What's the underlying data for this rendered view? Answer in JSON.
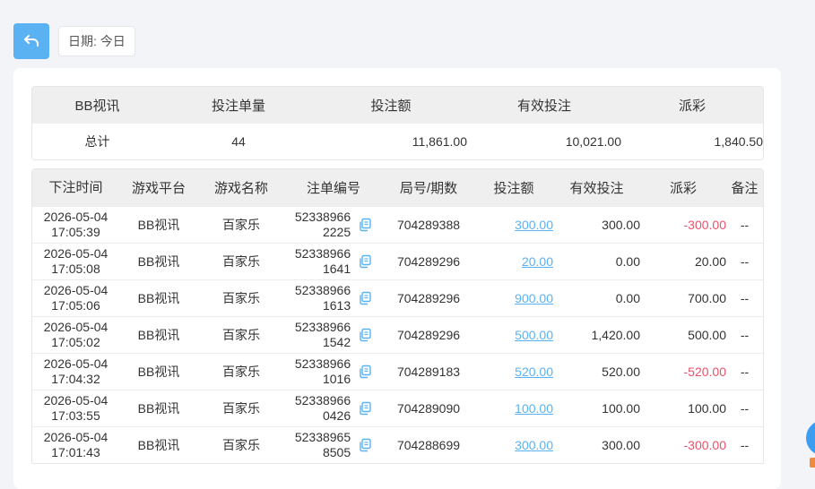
{
  "header": {
    "date_label": "日期: 今日"
  },
  "summary": {
    "columns": [
      "BB视讯",
      "投注单量",
      "投注额",
      "有效投注",
      "派彩"
    ],
    "total_row": {
      "label": "总计",
      "count": "44",
      "bet": "11,861.00",
      "valid": "10,021.00",
      "payout": "1,840.50"
    }
  },
  "detail": {
    "columns": [
      "下注时间",
      "游戏平台",
      "游戏名称",
      "注单编号",
      "局号/期数",
      "投注额",
      "有效投注",
      "派彩",
      "备注"
    ],
    "rows": [
      {
        "date": "2026-05-04",
        "time": "17:05:39",
        "platform": "BB视讯",
        "game": "百家乐",
        "order_a": "52338966",
        "order_b": "2225",
        "round": "704289388",
        "bet": "300.00",
        "valid": "300.00",
        "payout": "-300.00",
        "payout_negative": true,
        "note": "--"
      },
      {
        "date": "2026-05-04",
        "time": "17:05:08",
        "platform": "BB视讯",
        "game": "百家乐",
        "order_a": "52338966",
        "order_b": "1641",
        "round": "704289296",
        "bet": "20.00",
        "valid": "0.00",
        "payout": "20.00",
        "payout_negative": false,
        "note": "--"
      },
      {
        "date": "2026-05-04",
        "time": "17:05:06",
        "platform": "BB视讯",
        "game": "百家乐",
        "order_a": "52338966",
        "order_b": "1613",
        "round": "704289296",
        "bet": "900.00",
        "valid": "0.00",
        "payout": "700.00",
        "payout_negative": false,
        "note": "--"
      },
      {
        "date": "2026-05-04",
        "time": "17:05:02",
        "platform": "BB视讯",
        "game": "百家乐",
        "order_a": "52338966",
        "order_b": "1542",
        "round": "704289296",
        "bet": "500.00",
        "valid": "1,420.00",
        "payout": "500.00",
        "payout_negative": false,
        "note": "--"
      },
      {
        "date": "2026-05-04",
        "time": "17:04:32",
        "platform": "BB视讯",
        "game": "百家乐",
        "order_a": "52338966",
        "order_b": "1016",
        "round": "704289183",
        "bet": "520.00",
        "valid": "520.00",
        "payout": "-520.00",
        "payout_negative": true,
        "note": "--"
      },
      {
        "date": "2026-05-04",
        "time": "17:03:55",
        "platform": "BB视讯",
        "game": "百家乐",
        "order_a": "52338966",
        "order_b": "0426",
        "round": "704289090",
        "bet": "100.00",
        "valid": "100.00",
        "payout": "100.00",
        "payout_negative": false,
        "note": "--"
      },
      {
        "date": "2026-05-04",
        "time": "17:01:43",
        "platform": "BB视讯",
        "game": "百家乐",
        "order_a": "52338965",
        "order_b": "8505",
        "round": "704288699",
        "bet": "300.00",
        "valid": "300.00",
        "payout": "-300.00",
        "payout_negative": true,
        "note": "--"
      }
    ]
  },
  "icons": {
    "back": "undo-arrow-icon",
    "copy": "copy-icon"
  },
  "colors": {
    "accent": "#5ab2f3",
    "negative": "#e8526a"
  }
}
